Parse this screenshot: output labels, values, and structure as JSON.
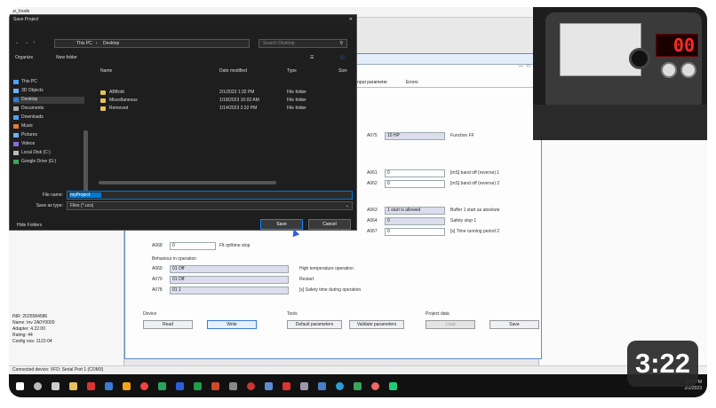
{
  "duration": "3:22",
  "cam": {
    "display_value": "00"
  },
  "app": {
    "titlebar": "sr_Inode",
    "left_info": [
      "INR: 2025584586",
      "Name: Inv 2A0Y0000",
      "Adapter: 4.22.00",
      "Rating: 44",
      "Config nos: 1122-04"
    ]
  },
  "param": {
    "tabs": [
      "input parameter",
      "Errors"
    ],
    "rows": [
      {
        "code": "A075",
        "value": "10 HP",
        "desc": "Function FF"
      },
      {
        "code": "A061",
        "value": "0",
        "desc": "[mS] band off (reverse) 1"
      },
      {
        "code": "A062",
        "value": "0",
        "desc": "[mS] band off (reverse) 2"
      },
      {
        "code": "A063",
        "value": "1 start is allowed",
        "desc": "Buffer 1 start as absolute"
      },
      {
        "code": "A064",
        "value": "0",
        "desc": "Safety stop 1"
      },
      {
        "code": "A067",
        "value": "0",
        "desc": "[s] Time running period 2"
      },
      {
        "code": "A068",
        "value": "0",
        "desc": "Flt rpt/time stop"
      }
    ],
    "group_label": "Behaviour in operation",
    "group_rows": [
      {
        "code": "A069",
        "value": "01 Off",
        "desc": "High temperature operation"
      },
      {
        "code": "A070",
        "value": "01 Off",
        "desc": "Restart"
      },
      {
        "code": "A078",
        "value": "01 1",
        "desc": "[s] Safety time during operation"
      }
    ],
    "sections": {
      "device": "Device",
      "tools": "Tools",
      "project_data": "Project data"
    },
    "buttons": {
      "read": "Read",
      "write": "Write",
      "default": "Default parameters",
      "validate": "Validate parameters",
      "load": "Load",
      "save": "Save"
    }
  },
  "dialog": {
    "title": "Save Project",
    "path": [
      "This PC",
      "Desktop"
    ],
    "search_placeholder": "Search Desktop",
    "organize": "Organize",
    "new_folder": "New folder",
    "nav_items": [
      "This PC",
      "3D Objects",
      "Desktop",
      "Documents",
      "Downloads",
      "Music",
      "Pictures",
      "Videos",
      "Local Disk (C:)",
      "Google Drive (G:)"
    ],
    "columns": [
      "Name",
      "Date modified",
      "Type",
      "Size"
    ],
    "files": [
      {
        "name": "ABBold",
        "date": "2/1/2023 1:32 PM",
        "type": "File folder"
      },
      {
        "name": "Miscellaneous",
        "date": "1/18/2023 10:02 AM",
        "type": "File folder"
      },
      {
        "name": "Removed",
        "date": "1/14/2023 2:32 PM",
        "type": "File folder"
      }
    ],
    "file_name_label": "File name:",
    "file_name_value": "myProject",
    "save_as_type_label": "Save as type:",
    "save_as_type_value": "Files (*.ucs)",
    "hide_folders": "Hide Folders",
    "save_label": "Save",
    "cancel_label": "Cancel"
  },
  "statusbar": "Connected device: VFD: Serial Port 1 (COM3)",
  "tray": {
    "time": "4:21 PM",
    "date": "2/2/2023"
  },
  "colors": {
    "accent": "#0078d4",
    "display_red": "#ff2a2a",
    "badge_bg": "#282828"
  }
}
